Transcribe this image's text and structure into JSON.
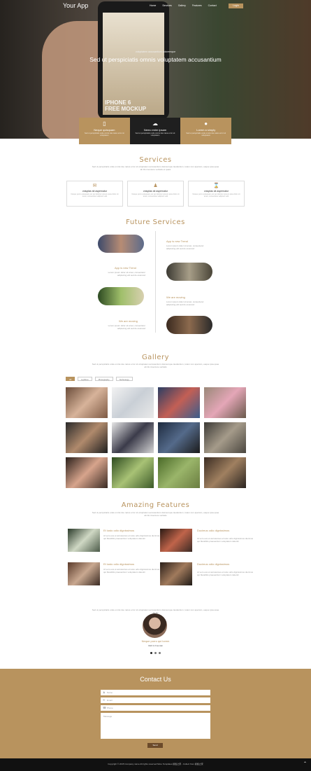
{
  "colors": {
    "accent": "#b8935e",
    "dark": "#1f1f1f",
    "footer": "#111111"
  },
  "nav": {
    "logo": "Your App",
    "items": [
      "Home",
      "Services",
      "Gallery",
      "Features",
      "Contact"
    ],
    "login": "Login"
  },
  "hero": {
    "kicker": "voluptatem accusantium doloremque",
    "title": "Sed ut perspiciatis omnis voluptatem accusantium",
    "screen_text": "IPHONE 6\nFREE MOCKUP"
  },
  "tiles": [
    {
      "icon": "phone-icon",
      "glyph": "▯",
      "title": "Neque quisquam",
      "desc": "Sed ut perspiciatis unde omnis iste natus error sit voluptatem"
    },
    {
      "icon": "cloud-upload-icon",
      "glyph": "☁",
      "title": "Nemo enim ipsam",
      "desc": "Sed ut perspiciatis unde omnis iste natus error sit voluptatem"
    },
    {
      "icon": "apple-icon",
      "glyph": "●",
      "title": "Lorem a simply",
      "desc": "Sed ut perspiciatis unde omnis iste natus error sit voluptatem"
    }
  ],
  "services": {
    "title": "Services",
    "intro": "Sed ut perspiciatis unde omnis iste natus error sit voluptatem accusantium doloremque laudantium, totam rem aperiam, eaque ipsa quae ab illo inventore veritatis et quasi",
    "cards": [
      {
        "icon": "envelope-icon",
        "glyph": "✉",
        "title": "voluptas sit aspernatur",
        "desc": "Neque porro quisquam est qui dolorem ipsum quia dolor sit amet, consectetur adipisci velit"
      },
      {
        "icon": "user-icon",
        "glyph": "♟",
        "title": "voluptas sit aspernatur",
        "desc": "Neque porro quisquam est qui dolorem ipsum quia dolor sit amet, consectetur adipisci velit"
      },
      {
        "icon": "hourglass-icon",
        "glyph": "⌛",
        "title": "voluptas sit aspernatur",
        "desc": "Neque porro quisquam est qui dolorem ipsum quia dolor sit amet, consectetur adipisci velit"
      }
    ]
  },
  "future": {
    "title": "Future Services",
    "items": [
      {
        "label": "App is new Trend",
        "desc": "Lorem ipsum dolor sit amet, consectetur adipiscing elit sed do eiusmod"
      },
      {
        "label": "App is new Trend",
        "desc": "Lorem ipsum dolor sit amet, consectetur adipiscing elit sed do eiusmod"
      },
      {
        "label": "We are moving",
        "desc": "Lorem ipsum dolor sit amet, consectetur adipiscing elit sed do eiusmod"
      },
      {
        "label": "We are moving",
        "desc": "Lorem ipsum dolor sit amet, consectetur adipiscing elit sed do eiusmod"
      }
    ]
  },
  "gallery": {
    "title": "Gallery",
    "intro": "Sed ut perspiciatis unde omnis iste natus error sit voluptatem accusantium doloremque laudantium, totam rem aperiam, eaque ipsa quae ab illo inventore veritatis",
    "filters": [
      "All",
      "Lightbox",
      "Photography",
      "Technology"
    ]
  },
  "amazing": {
    "title": "Amazing Features",
    "intro": "Sed ut perspiciatis unde omnis iste natus error sit voluptatem accusantium doloremque laudantium, totam rem aperiam, eaque ipsa quae ab illo inventore veritatis",
    "items": [
      {
        "title": "Et iusto odio dignissimos",
        "desc": "At vero eos et accusamus et iusto odio dignissimos ducimus qui blanditiis praesentium voluptatum deleniti"
      },
      {
        "title": "Ducimus odio dignissimos",
        "desc": "At vero eos et accusamus et iusto odio dignissimos ducimus qui blanditiis praesentium voluptatum deleniti"
      },
      {
        "title": "Et iusto odio dignissimos",
        "desc": "At vero eos et accusamus et iusto odio dignissimos ducimus qui blanditiis praesentium voluptatum deleniti"
      },
      {
        "title": "Ducimus odio dignissimos",
        "desc": "At vero eos et accusamus et iusto odio dignissimos ducimus qui blanditiis praesentium voluptatum deleniti"
      }
    ]
  },
  "testimonial": {
    "quote": "Sed ut perspiciatis unde omnis iste natus error sit voluptatem accusantium doloremque laudantium, totam rem aperiam, eaque ipsa quae ab illo",
    "name": "Neque porro qui lorem",
    "role": "CEO & Founder"
  },
  "contact": {
    "title": "Contact Us",
    "name_placeholder": "Name",
    "email_placeholder": "Email",
    "phone_placeholder": "Phone",
    "message_placeholder": "Message",
    "send": "Send"
  },
  "footer": {
    "text": "Copyright © 2015 Company name All rights reserved More Templates 模板之家 - Collect from 模板之家"
  }
}
